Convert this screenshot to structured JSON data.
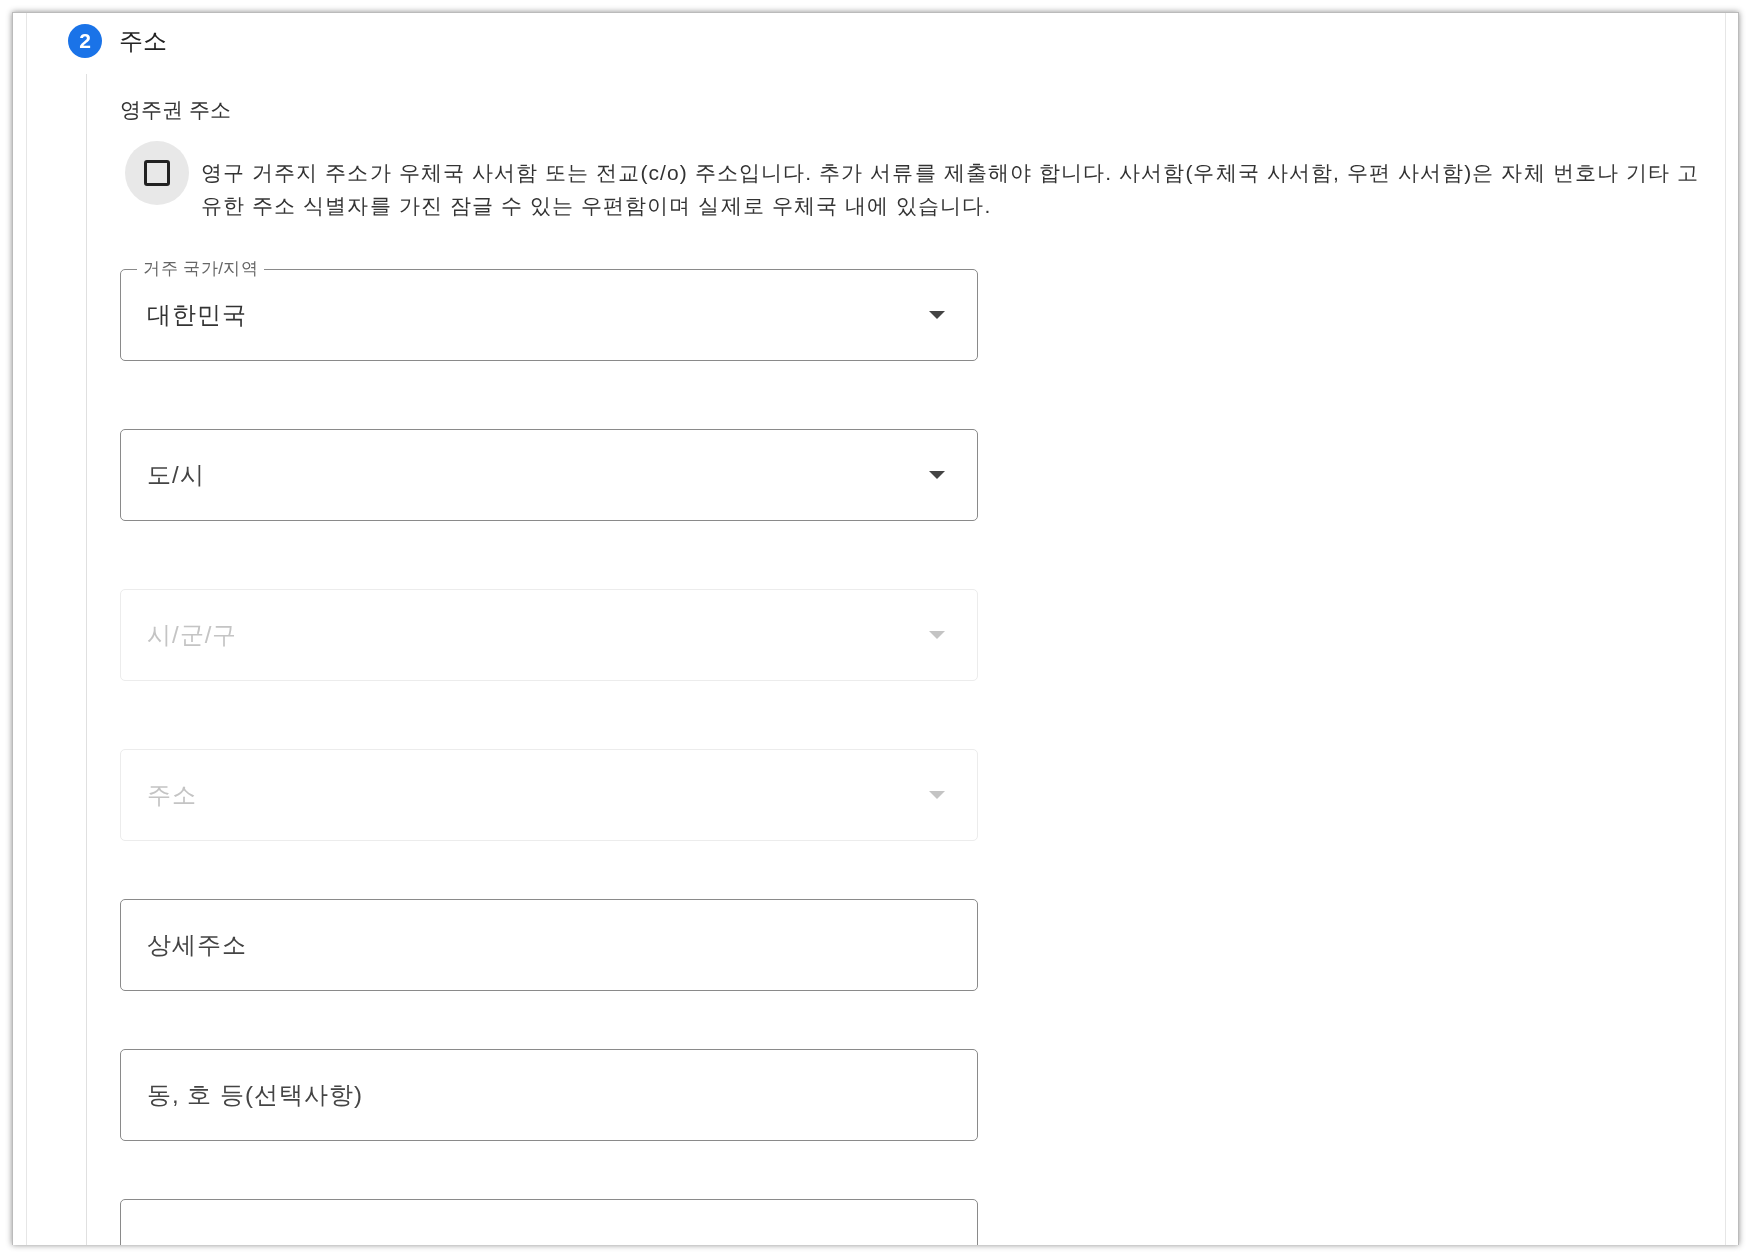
{
  "section": {
    "number": "2",
    "title": "주소"
  },
  "subtitle": "영주권 주소",
  "po_box": {
    "checked": false,
    "text": "영구 거주지 주소가 우체국 사서함 또는 전교(c/o) 주소입니다. 추가 서류를 제출해야 합니다. 사서함(우체국 사서함, 우편 사서함)은 자체 번호나 기타 고유한 주소 식별자를 가진 잠글 수 있는 우편함이며 실제로 우체국 내에 있습니다."
  },
  "fields": [
    {
      "kind": "select",
      "label": "거주 국가/지역",
      "value": "대한민국",
      "disabled": false
    },
    {
      "kind": "select",
      "placeholder": "도/시",
      "disabled": false
    },
    {
      "kind": "select",
      "placeholder": "시/군/구",
      "disabled": true
    },
    {
      "kind": "select",
      "placeholder": "주소",
      "disabled": true
    },
    {
      "kind": "text",
      "placeholder": "상세주소",
      "disabled": false
    },
    {
      "kind": "text",
      "placeholder": "동, 호 등(선택사항)",
      "disabled": false
    },
    {
      "kind": "text",
      "disabled": false
    }
  ]
}
